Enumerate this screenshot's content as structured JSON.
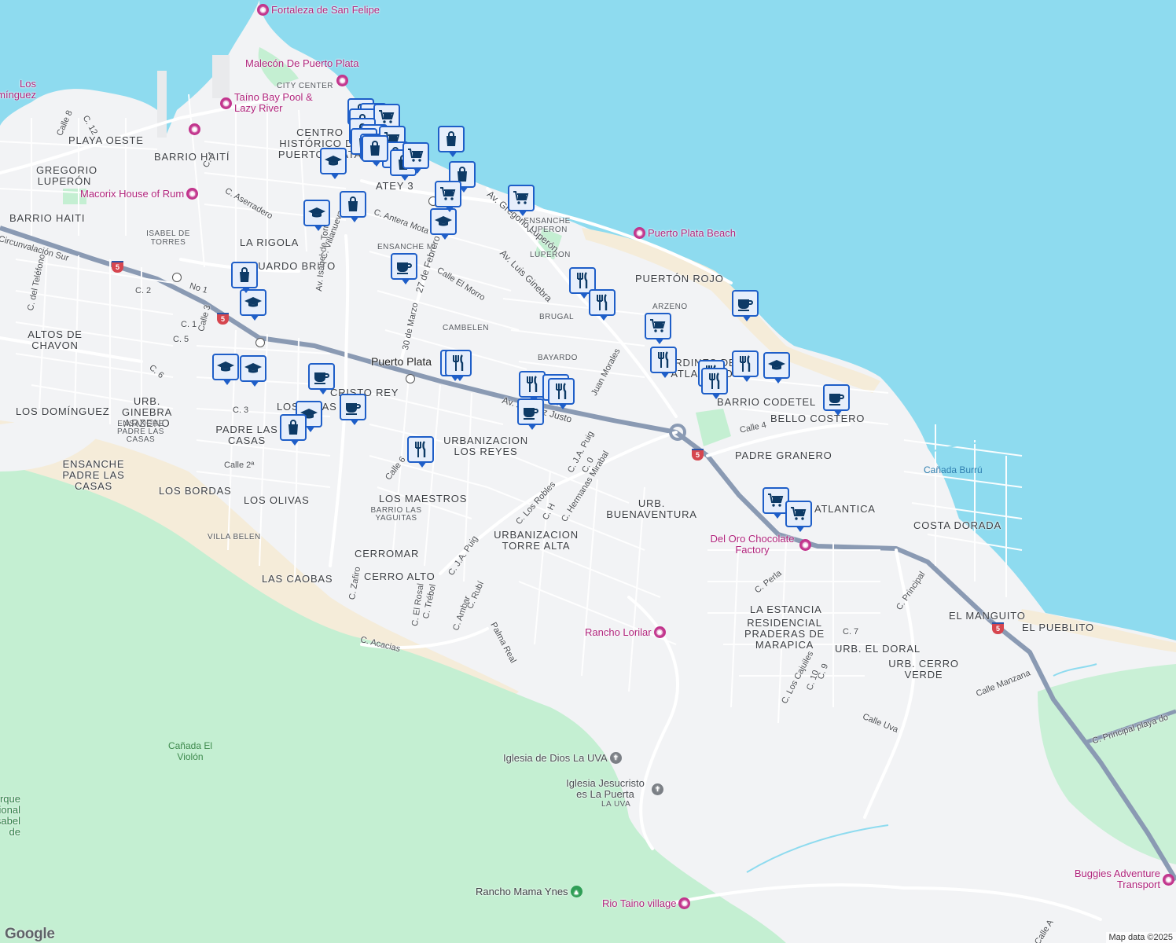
{
  "map": {
    "colors": {
      "water": "#8edbef",
      "land": "#f2f3f5",
      "park": "#c4efd2",
      "sand": "#f5ecd9",
      "road": "#ffffff",
      "highway": "#8a9ab3",
      "poi": "#c2338c",
      "pin": "#1e5ec8"
    },
    "neighborhoods": [
      "PLAYA OESTE",
      "BARRIO HAITÍ",
      "GREGORIO LUPERÓN",
      "BARRIO HAITI",
      "ISABEL DE TORRES",
      "CITY CENTER",
      "CENTRO HISTÓRICO DE PUERTO PLATA",
      "LA RIGOLA",
      "ENSANCHE LUPERON",
      "LUPERON",
      "PUERTÓN ROJO",
      "ARZENO",
      "BRUGAL",
      "BAYARDO",
      "CAMBELEN",
      "ALTOS DE CHAVON",
      "LOS DOMÍNGUEZ",
      "URB. GINEBRA ARZENO",
      "ENSANCHE PADRE LAS CASAS",
      "PADRE LAS CASAS",
      "ENSANCHE PADRE LAS CASAS",
      "LOS BORDAS",
      "LOS OLIVAS",
      "VILLA BELEN",
      "URBANIZACION LOS REYES",
      "LOS MAESTROS",
      "BARRIO LAS YAGUITAS",
      "CERROMAR",
      "CERRO ALTO",
      "LAS CAOBAS",
      "URBANIZACION TORRE ALTA",
      "URB. BUENAVENTURA",
      "BARRIO CODETEL",
      "BELLO COSTERO",
      "PADRE GRANERO",
      "ATLANTICA",
      "COSTA DORADA",
      "LA ESTANCIA",
      "RESIDENCIAL PRADERAS DE MARAPICA",
      "URB. EL DORAL",
      "URB. CERRO VERDE",
      "EL MANGUITO",
      "EL PUEBLITO",
      "LA UVA",
      "ENSANCHE MI",
      "DUARDO BRITO",
      "CRISTO REY",
      "LOS RIDAS",
      "ATEY 3",
      "JARDINES DEL ATLANTICO"
    ],
    "streets": [
      "Circunvalación Sur",
      "Av. Isabel de Torres",
      "27 de Febrero",
      "30 de Marzo",
      "Av. Luis Ginebra",
      "Av. Gregorio Luperón",
      "Av. Álvarez Justo",
      "Juan Morales",
      "C. J.A. Puig",
      "C. J.A. Puig",
      "C. Hermanas Mirabal",
      "C. Los Robles",
      "C. Antera Mota",
      "Calle El Morro",
      "C. Villanueva",
      "C. Aserradero",
      "Calle 6",
      "Calle 3",
      "Calle 2ª",
      "Calle 4",
      "Calle Uva",
      "Calle Manzana",
      "C. Principal playa do",
      "C. Acacias",
      "Palma Real",
      "C. Zafiro",
      "C. El Rosal",
      "C. Trébol",
      "C. Ambar",
      "C. Rubí",
      "C. Perla",
      "C. Principal",
      "C. Los Cajuiles",
      "C. del Teléfono",
      "Calle 8",
      "C. 12",
      "C. 4",
      "No 1",
      "C. 2",
      "C. 1",
      "C. 5",
      "C. 6",
      "C. 3",
      "C. 7",
      "C. 9",
      "C. 10",
      "C. H",
      "C. 0",
      "Calle A"
    ],
    "water_labels": [
      "Cañada Burrú",
      "Cañada El Violón"
    ],
    "pois": [
      {
        "name": "Fortaleza de San Felipe",
        "kind": "poi"
      },
      {
        "name": "Malecón De Puerto Plata",
        "kind": "poi"
      },
      {
        "name": "Taíno Bay Pool & Lazy River",
        "kind": "poi"
      },
      {
        "name": "Macorix House of Rum",
        "kind": "poi"
      },
      {
        "name": "Puerto Plata Beach",
        "kind": "poi"
      },
      {
        "name": "Del Oro Chocolate Factory",
        "kind": "poi"
      },
      {
        "name": "Rancho Lorilar",
        "kind": "poi"
      },
      {
        "name": "Iglesia de Dios La UVA",
        "kind": "church"
      },
      {
        "name": "Iglesia Jesucristo es La Puerta",
        "kind": "church"
      },
      {
        "name": "Rancho Mama Ynes",
        "kind": "park"
      },
      {
        "name": "Rio Taino village",
        "kind": "poi"
      },
      {
        "name": "Buggies Adventure Transport",
        "kind": "poi"
      },
      {
        "name": "Puerto Plata",
        "kind": "transit"
      },
      {
        "name": "Los Domínguez",
        "kind": "poi"
      },
      {
        "name": "Parque Nacional Isabel de Torres",
        "kind": "park"
      }
    ],
    "highway_shield": "5",
    "pins": [
      "shopping-bag",
      "cart",
      "shopping-bag",
      "cart",
      "shopping-bag",
      "shopping-bag",
      "school",
      "shopping-bag",
      "shopping-bag",
      "cart",
      "shopping-bag",
      "shopping-bag",
      "shopping-bag",
      "shopping-bag",
      "cart",
      "school",
      "shopping-bag",
      "school",
      "cart",
      "coffee",
      "school",
      "cart",
      "shopping-bag",
      "school",
      "restaurant",
      "restaurant",
      "cart",
      "coffee",
      "restaurant",
      "restaurant",
      "restaurant",
      "restaurant",
      "restaurant",
      "school",
      "coffee",
      "shopping-bag",
      "school",
      "coffee",
      "coffee",
      "school",
      "shopping-bag",
      "restaurant",
      "restaurant",
      "restaurant",
      "restaurant",
      "coffee",
      "restaurant",
      "cart",
      "cart"
    ],
    "google_logo": "Google",
    "attribution": "Map data ©2025"
  }
}
